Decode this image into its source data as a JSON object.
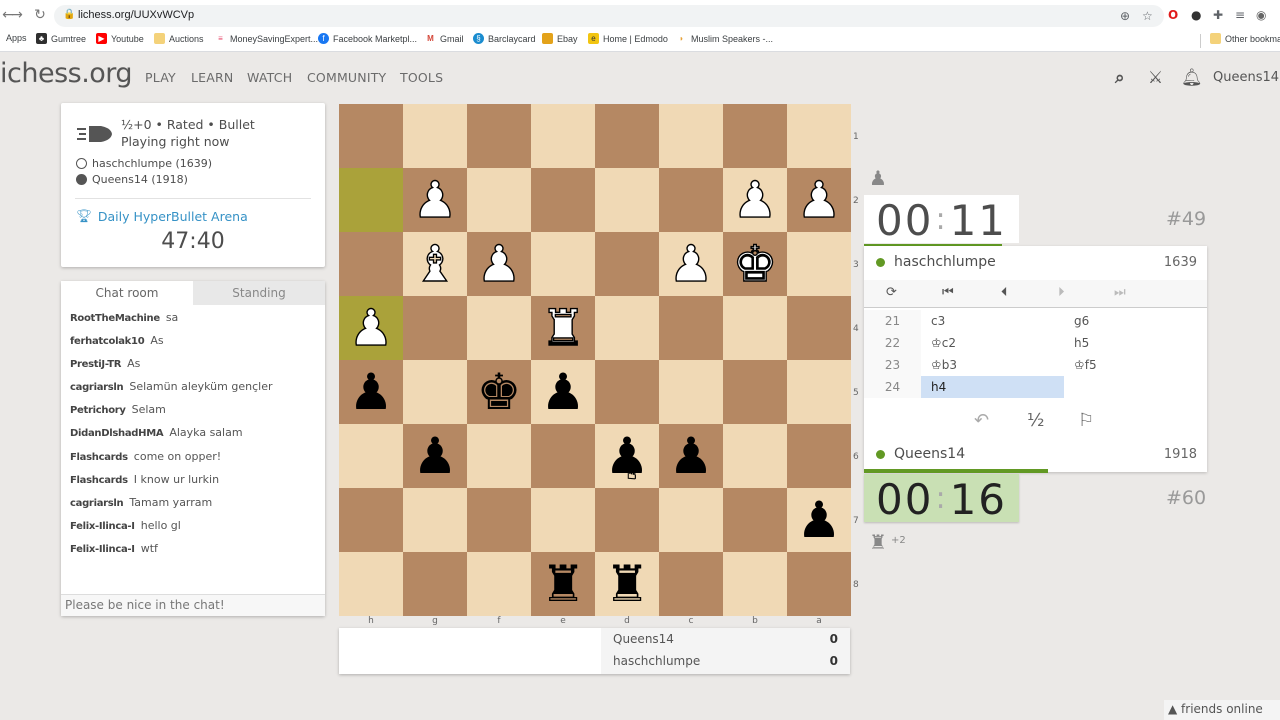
{
  "browser": {
    "url": "lichess.org/UUXvWCVp",
    "bookmarks": [
      {
        "label": "Apps",
        "icon": "apps-grid",
        "color": "#4285f4"
      },
      {
        "label": "Gumtree",
        "icon": "gumtree-logo",
        "color": "#2f2f2f"
      },
      {
        "label": "Youtube",
        "icon": "youtube-logo",
        "color": "#ff0000"
      },
      {
        "label": "Auctions",
        "icon": "folder",
        "color": "#f4d27a"
      },
      {
        "label": "MoneySavingExpert...",
        "icon": "mse-logo",
        "color": "#e8476a"
      },
      {
        "label": "Facebook Marketpl...",
        "icon": "facebook-logo",
        "color": "#1877f2"
      },
      {
        "label": "Gmail",
        "icon": "gmail-logo",
        "color": "#d44638"
      },
      {
        "label": "Barclaycard",
        "icon": "barclaycard-logo",
        "color": "#1a8ccf"
      },
      {
        "label": "Ebay",
        "icon": "ebay-bag",
        "color": "#e3a21a"
      },
      {
        "label": "Home | Edmodo",
        "icon": "edmodo-logo",
        "color": "#f2c511"
      },
      {
        "label": "Muslim Speakers -...",
        "icon": "muslim-speakers-logo",
        "color": "#e8a33b"
      }
    ],
    "other_bookmarks": "Other bookma"
  },
  "header": {
    "logo": "ichess.org",
    "nav": [
      "PLAY",
      "LEARN",
      "WATCH",
      "COMMUNITY",
      "TOOLS"
    ],
    "username": "Queens14"
  },
  "game_info": {
    "line1": "½+0 • Rated • Bullet",
    "line2": "Playing right now",
    "white_player": "haschchlumpe (1639)",
    "black_player": "Queens14 (1918)",
    "tournament": "Daily HyperBullet Arena",
    "tournament_clock": "47:40"
  },
  "chat": {
    "tabs": [
      "Chat room",
      "Standing"
    ],
    "active_tab": "Chat room",
    "messages": [
      {
        "user": "RootTheMachine",
        "text": "sa"
      },
      {
        "user": "ferhatcolak10",
        "text": "As"
      },
      {
        "user": "PrestiJ-TR",
        "text": "As"
      },
      {
        "user": "cagriarsln",
        "text": "Selamün aleyküm gençler"
      },
      {
        "user": "Petrichory",
        "text": "Selam"
      },
      {
        "user": "DidanDlshadHMA",
        "text": "Alayka salam"
      },
      {
        "user": "Flashcards",
        "text": "come on opper!"
      },
      {
        "user": "Flashcards",
        "text": "I know ur lurkin"
      },
      {
        "user": "cagriarsln",
        "text": "Tamam yarram"
      },
      {
        "user": "Felix-Ilinca-I",
        "text": "hello gl"
      },
      {
        "user": "Felix-Ilinca-I",
        "text": "wtf"
      }
    ],
    "input_placeholder": "Please be nice in the chat!"
  },
  "board": {
    "orientation": "black",
    "files_display": [
      "h",
      "g",
      "f",
      "e",
      "d",
      "c",
      "b",
      "a"
    ],
    "ranks_display": [
      "1",
      "2",
      "3",
      "4",
      "5",
      "6",
      "7",
      "8"
    ],
    "last_move": [
      "h2",
      "h4"
    ],
    "pieces": [
      {
        "square": "g2",
        "piece": "P"
      },
      {
        "square": "b2",
        "piece": "P"
      },
      {
        "square": "a2",
        "piece": "P"
      },
      {
        "square": "g3",
        "piece": "B"
      },
      {
        "square": "f3",
        "piece": "P"
      },
      {
        "square": "c3",
        "piece": "P"
      },
      {
        "square": "b3",
        "piece": "K"
      },
      {
        "square": "h4",
        "piece": "P"
      },
      {
        "square": "e4",
        "piece": "R"
      },
      {
        "square": "h5",
        "piece": "p"
      },
      {
        "square": "f5",
        "piece": "k"
      },
      {
        "square": "e5",
        "piece": "p"
      },
      {
        "square": "g6",
        "piece": "p"
      },
      {
        "square": "d6",
        "piece": "p"
      },
      {
        "square": "c6",
        "piece": "p"
      },
      {
        "square": "a7",
        "piece": "p"
      },
      {
        "square": "e8",
        "piece": "r"
      },
      {
        "square": "d8",
        "piece": "r"
      }
    ]
  },
  "tournament_standing": [
    {
      "name": "Queens14",
      "score": "0"
    },
    {
      "name": "haschchlumpe",
      "score": "0"
    }
  ],
  "opponent": {
    "name": "haschchlumpe",
    "rating": "1639",
    "clock_min": "00",
    "clock_sec": "11",
    "clock_fraction": 0.8,
    "rank": "#49",
    "captured_icon": "pawn"
  },
  "player": {
    "name": "Queens14",
    "rating": "1918",
    "clock_min": "00",
    "clock_sec": "16",
    "clock_fraction": 0.55,
    "rank": "#60",
    "captured_icon": "rook",
    "material_diff": "+2"
  },
  "controls": {
    "flip": "⟳",
    "first": "⏮",
    "prev": "⏴",
    "next": "⏵",
    "last": "⏭"
  },
  "moves": [
    {
      "n": "21",
      "white": "c3",
      "black": "g6"
    },
    {
      "n": "22",
      "white": "♔c2",
      "black": "h5"
    },
    {
      "n": "23",
      "white": "♔b3",
      "black": "♔f5"
    },
    {
      "n": "24",
      "white": "h4",
      "black": ""
    }
  ],
  "active_move": "24.white",
  "actions": {
    "takeback": "↶",
    "draw": "½",
    "resign": "⚐"
  },
  "friends": "friends online"
}
